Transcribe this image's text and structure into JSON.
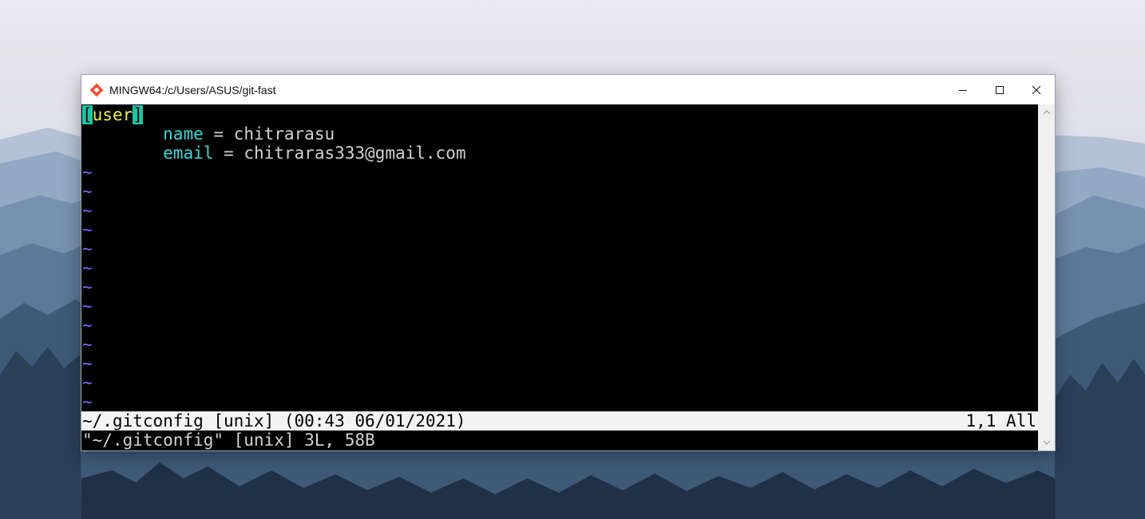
{
  "window": {
    "title": "MINGW64:/c/Users/ASUS/git-fast",
    "controls": {
      "minimize": "minimize-icon",
      "maximize": "maximize-icon",
      "close": "close-icon"
    }
  },
  "editor": {
    "section_open": "[",
    "section_name": "user",
    "section_close": "]",
    "entries": [
      {
        "indent": "        ",
        "key": "name",
        "sep": " = ",
        "value": "chitrarasu"
      },
      {
        "indent": "        ",
        "key": "email",
        "sep": " = ",
        "value": "chitraras333@gmail.com"
      }
    ],
    "empty_line_marker": "~",
    "empty_lines": 13,
    "status_left": "~/.gitconfig [unix] (00:43 06/01/2021)",
    "status_right": "1,1 All",
    "message": "\"~/.gitconfig\" [unix] 3L, 58B"
  },
  "colors": {
    "section_bracket_bg": "#19c6a6",
    "section_name": "#f2ef3a",
    "key": "#39d8d8",
    "tilde": "#6f6cff",
    "text": "#d2d2d2"
  }
}
